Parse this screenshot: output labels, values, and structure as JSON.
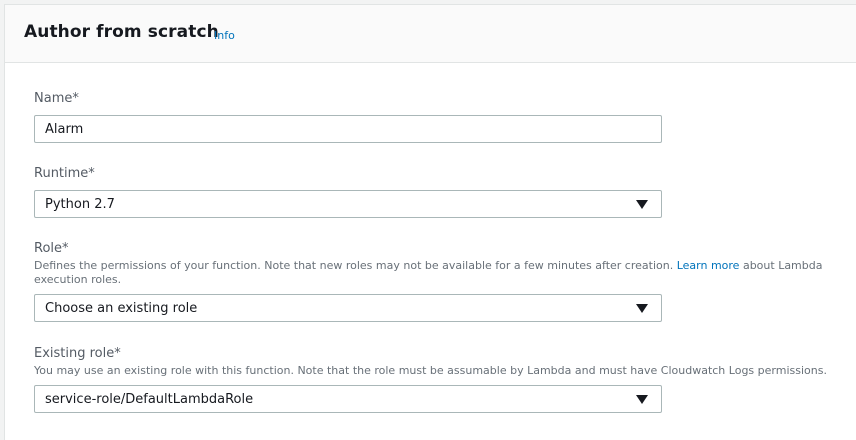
{
  "section": {
    "title": "Author from scratch",
    "info_label": "Info"
  },
  "name_field": {
    "label": "Name*",
    "value": "Alarm"
  },
  "runtime_field": {
    "label": "Runtime*",
    "selected": "Python 2.7"
  },
  "role_field": {
    "label": "Role*",
    "description_prefix": "Defines the permissions of your function. Note that new roles may not be available for a few minutes after creation.",
    "learn_more": "Learn more",
    "description_suffix": "about Lambda execution roles.",
    "selected": "Choose an existing role"
  },
  "existing_role_field": {
    "label": "Existing role*",
    "description": "You may use an existing role with this function. Note that the role must be assumable by Lambda and must have Cloudwatch Logs permissions.",
    "selected": "service-role/DefaultLambdaRole"
  },
  "icons": {
    "dropdown": "caret-down-icon"
  },
  "colors": {
    "link": "#0073bb",
    "label": "#545b64",
    "border": "#aab7b8"
  }
}
